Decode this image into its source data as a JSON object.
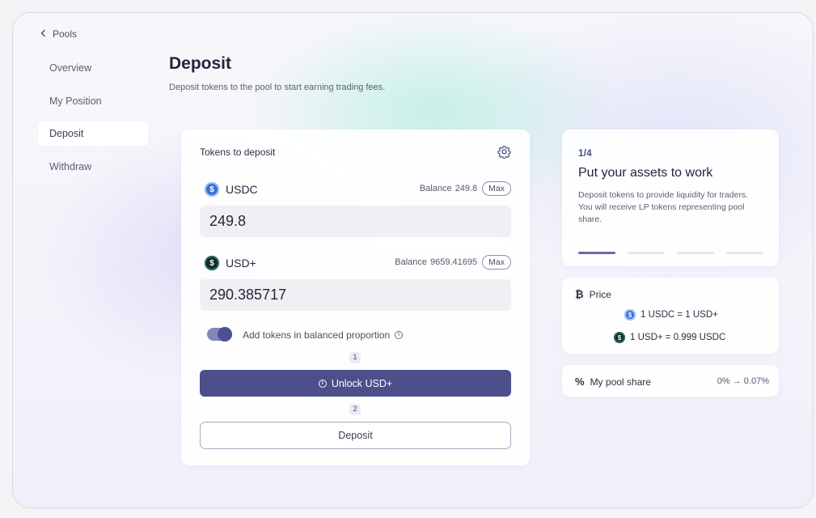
{
  "nav": {
    "back_label": "Pools",
    "items": [
      {
        "label": "Overview"
      },
      {
        "label": "My Position"
      },
      {
        "label": "Deposit"
      },
      {
        "label": "Withdraw"
      }
    ],
    "active": "Deposit"
  },
  "header": {
    "title": "Deposit",
    "subtitle": "Deposit tokens to the pool to start earning trading fees."
  },
  "deposit_form": {
    "section_label": "Tokens to deposit",
    "tokens": [
      {
        "symbol": "USDC",
        "balance_label": "Balance",
        "balance": "249.8",
        "max_label": "Max",
        "amount": "249.8"
      },
      {
        "symbol": "USD+",
        "balance_label": "Balance",
        "balance": "9659.41695",
        "max_label": "Max",
        "amount": "290.385717"
      }
    ],
    "balanced_toggle": {
      "label": "Add tokens in balanced proportion",
      "on": true
    },
    "steps": [
      {
        "number": "1",
        "button_label": "Unlock USD+"
      },
      {
        "number": "2",
        "button_label": "Deposit"
      }
    ]
  },
  "info_panel": {
    "step": "1/4",
    "title": "Put your assets to work",
    "description": "Deposit tokens to provide liquidity for traders. You will receive LP tokens representing pool share.",
    "progress_total": 4,
    "progress_active": 1
  },
  "price_panel": {
    "title": "Price",
    "lines": [
      "1 USDC = 1 USD+",
      "1 USD+ = 0.999 USDC"
    ]
  },
  "share_panel": {
    "label": "My pool share",
    "value": "0% → 0.07%"
  },
  "colors": {
    "accent": "#4c4f8a",
    "toggle_track": "#8486b8",
    "usdc_coin": "#3a6fd8",
    "usdplus_coin": "#0f2a2a"
  },
  "icons": {
    "back": "chevron-left-icon",
    "settings": "gear-icon",
    "info": "info-icon",
    "price": "bitcoin-icon",
    "share": "percent-icon"
  }
}
